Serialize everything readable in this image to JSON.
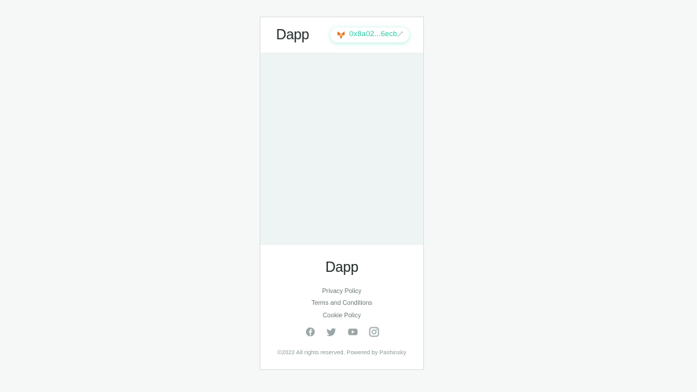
{
  "header": {
    "brand": "Dapp",
    "wallet": {
      "address": "0x8a02...6ecb",
      "wallet_icon": "metamask-fox-icon",
      "edit_icon": "pencil-icon",
      "accent": "#2cc8a4"
    }
  },
  "footer": {
    "brand": "Dapp",
    "links": {
      "privacy": "Privacy Policy",
      "terms": "Terms and Conditions",
      "cookie": "Cookie Policy"
    },
    "socials": [
      "facebook-icon",
      "twitter-icon",
      "youtube-icon",
      "instagram-icon"
    ],
    "copyright": "©2022 All rights reserved. Powered by Pashinsky"
  },
  "colors": {
    "page_bg": "#f6f8f8",
    "content_bg": "#eef4f4",
    "icon_gray": "#9aa5a5"
  }
}
